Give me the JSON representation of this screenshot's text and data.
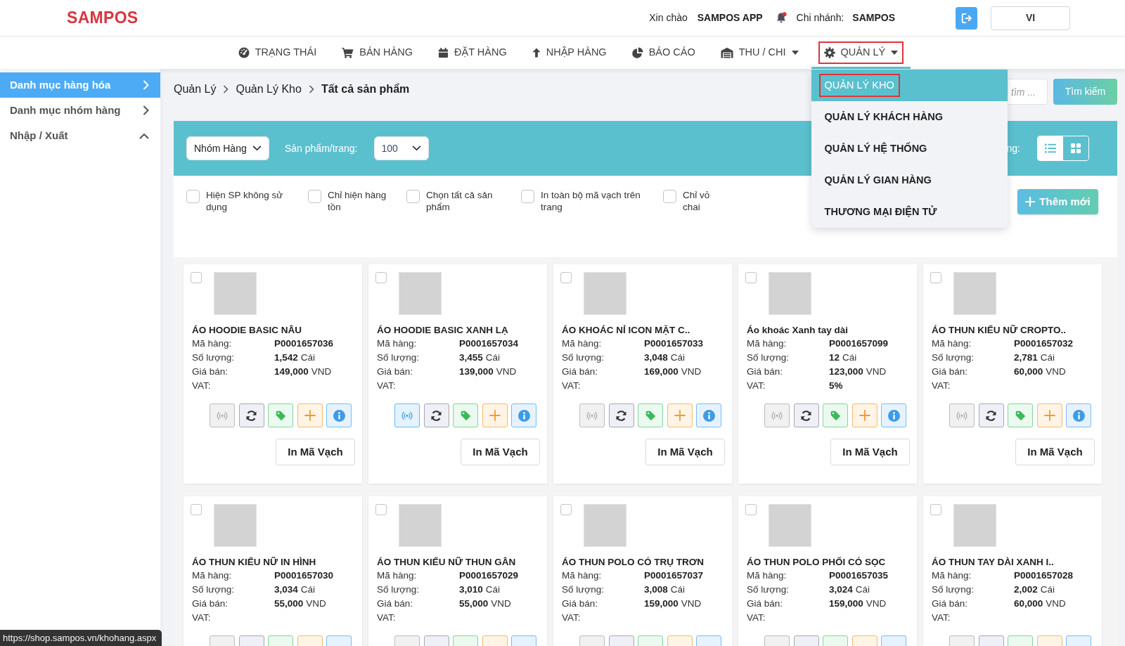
{
  "header": {
    "logo": "SAMPOS",
    "greeting": "Xin chào",
    "user": "SAMPOS APP",
    "notification_dot": true,
    "branch_label": "Chi nhánh:",
    "branch": "SAMPOS",
    "language": "VI"
  },
  "nav": [
    {
      "label": "TRẠNG THÁI",
      "dropdown": false,
      "selected": false,
      "highlighted": false
    },
    {
      "label": "BÁN HÀNG",
      "dropdown": false,
      "selected": false,
      "highlighted": false
    },
    {
      "label": "ĐẶT HÀNG",
      "dropdown": false,
      "selected": false,
      "highlighted": false
    },
    {
      "label": "NHẬP HÀNG",
      "dropdown": false,
      "selected": false,
      "highlighted": false
    },
    {
      "label": "BÁO CÁO",
      "dropdown": false,
      "selected": false,
      "highlighted": false
    },
    {
      "label": "THU / CHI",
      "dropdown": true,
      "selected": false,
      "highlighted": false
    },
    {
      "label": "QUẢN LÝ",
      "dropdown": true,
      "selected": true,
      "highlighted": true,
      "menu": [
        {
          "label": "QUẢN LÝ KHO",
          "selected": true,
          "highlighted": true
        },
        {
          "label": "QUẢN LÝ KHÁCH HÀNG",
          "selected": false,
          "highlighted": false
        },
        {
          "label": "QUẢN LÝ HỆ THỐNG",
          "selected": false,
          "highlighted": false
        },
        {
          "label": "QUẢN LÝ GIAN HÀNG",
          "selected": false,
          "highlighted": false
        },
        {
          "label": "THƯƠNG MẠI ĐIỆN TỬ",
          "selected": false,
          "highlighted": false
        }
      ]
    }
  ],
  "sidebar": {
    "items": [
      {
        "label": "Danh mục hàng hóa",
        "kind": "link",
        "selected": true
      },
      {
        "label": "Danh mục nhóm hàng",
        "kind": "link",
        "selected": false
      },
      {
        "label": "Nhập / Xuất",
        "kind": "group",
        "expanded": true,
        "selected": false
      }
    ]
  },
  "breadcrumb": [
    "Quản Lý",
    "Quản Lý Kho",
    "Tất cả sản phẩm"
  ],
  "search": {
    "placeholder": "tìm ...",
    "button": "Tìm kiếm"
  },
  "filter_bar": {
    "group_select": "Nhóm Hàng",
    "page_size_label": "Sản phẩm/trang:",
    "page_size": "100",
    "view_label": "ng:",
    "views": [
      {
        "kind": "list",
        "selected": false
      },
      {
        "kind": "grid",
        "selected": true
      }
    ]
  },
  "options": [
    {
      "label": "Hiện SP không sử dụng",
      "checked": false
    },
    {
      "label": "Chỉ hiện hàng tồn",
      "checked": false
    },
    {
      "label": "Chọn tất cả sản phẩm",
      "checked": false
    },
    {
      "label": "In toàn bộ mã vạch trên trang",
      "checked": false
    },
    {
      "label": "Chỉ vỏ chai",
      "checked": false
    }
  ],
  "add_button": "Thêm mới",
  "products": [
    {
      "checked": false,
      "name": "ÁO HOODIE BASIC NÂU",
      "fields": [
        {
          "label": "Mã hàng:",
          "value": "P0001657036"
        },
        {
          "label": "Số lượng:",
          "value": "1,542",
          "unit": "Cái"
        },
        {
          "label": "Giá bán:",
          "value": "149,000",
          "unit": "VND"
        },
        {
          "label": "VAT:"
        }
      ],
      "broadcast_active": false,
      "print_button": "In Mã Vạch"
    },
    {
      "checked": false,
      "name": "ÁO HOODIE BASIC XANH LẠ",
      "fields": [
        {
          "label": "Mã hàng:",
          "value": "P0001657034"
        },
        {
          "label": "Số lượng:",
          "value": "3,455",
          "unit": "Cái"
        },
        {
          "label": "Giá bán:",
          "value": "139,000",
          "unit": "VND"
        },
        {
          "label": "VAT:"
        }
      ],
      "broadcast_active": true,
      "print_button": "In Mã Vạch"
    },
    {
      "checked": false,
      "name": "ÁO KHOÁC NỈ ICON MẶT C..",
      "fields": [
        {
          "label": "Mã hàng:",
          "value": "P0001657033"
        },
        {
          "label": "Số lượng:",
          "value": "3,048",
          "unit": "Cái"
        },
        {
          "label": "Giá bán:",
          "value": "169,000",
          "unit": "VND"
        },
        {
          "label": "VAT:"
        }
      ],
      "broadcast_active": false,
      "print_button": "In Mã Vạch"
    },
    {
      "checked": false,
      "name": "Áo khoác Xanh tay dài",
      "fields": [
        {
          "label": "Mã hàng:",
          "value": "P0001657099"
        },
        {
          "label": "Số lượng:",
          "value": "12",
          "unit": "Cái"
        },
        {
          "label": "Giá bán:",
          "value": "123,000",
          "unit": "VND"
        },
        {
          "label": "VAT:",
          "value": "5%"
        }
      ],
      "broadcast_active": false,
      "print_button": "In Mã Vạch"
    },
    {
      "checked": false,
      "name": "ÁO THUN KIỂU NỮ CROPTO..",
      "fields": [
        {
          "label": "Mã hàng:",
          "value": "P0001657032"
        },
        {
          "label": "Số lượng:",
          "value": "2,781",
          "unit": "Cái"
        },
        {
          "label": "Giá bán:",
          "value": "60,000",
          "unit": "VND"
        },
        {
          "label": "VAT:"
        }
      ],
      "broadcast_active": false,
      "print_button": "In Mã Vạch"
    },
    {
      "checked": false,
      "name": "ÁO THUN KIỂU NỮ IN HÌNH",
      "fields": [
        {
          "label": "Mã hàng:",
          "value": "P0001657030"
        },
        {
          "label": "Số lượng:",
          "value": "3,034",
          "unit": "Cái"
        },
        {
          "label": "Giá bán:",
          "value": "55,000",
          "unit": "VND"
        },
        {
          "label": "VAT:"
        }
      ],
      "broadcast_active": false
    },
    {
      "checked": false,
      "name": "ÁO THUN KIỂU NỮ THUN GÂN",
      "fields": [
        {
          "label": "Mã hàng:",
          "value": "P0001657029"
        },
        {
          "label": "Số lượng:",
          "value": "3,010",
          "unit": "Cái"
        },
        {
          "label": "Giá bán:",
          "value": "55,000",
          "unit": "VND"
        },
        {
          "label": "VAT:"
        }
      ],
      "broadcast_active": false
    },
    {
      "checked": false,
      "name": "ÁO THUN POLO CÓ TRỤ TRƠN",
      "fields": [
        {
          "label": "Mã hàng:",
          "value": "P0001657037"
        },
        {
          "label": "Số lượng:",
          "value": "3,008",
          "unit": "Cái"
        },
        {
          "label": "Giá bán:",
          "value": "159,000",
          "unit": "VND"
        },
        {
          "label": "VAT:"
        }
      ],
      "broadcast_active": false
    },
    {
      "checked": false,
      "name": "ÁO THUN POLO PHỐI CÓ SỌC",
      "fields": [
        {
          "label": "Mã hàng:",
          "value": "P0001657035"
        },
        {
          "label": "Số lượng:",
          "value": "3,024",
          "unit": "Cái"
        },
        {
          "label": "Giá bán:",
          "value": "159,000",
          "unit": "VND"
        },
        {
          "label": "VAT:"
        }
      ],
      "broadcast_active": false
    },
    {
      "checked": false,
      "name": "ÁO THUN TAY DÀI XANH I..",
      "fields": [
        {
          "label": "Mã hàng:",
          "value": "P0001657028"
        },
        {
          "label": "Số lượng:",
          "value": "2,002",
          "unit": "Cái"
        },
        {
          "label": "Giá bán:",
          "value": "60,000",
          "unit": "VND"
        },
        {
          "label": "VAT:"
        }
      ],
      "broadcast_active": false
    }
  ],
  "status_url": "https://shop.sampos.vn/khohang.aspx"
}
